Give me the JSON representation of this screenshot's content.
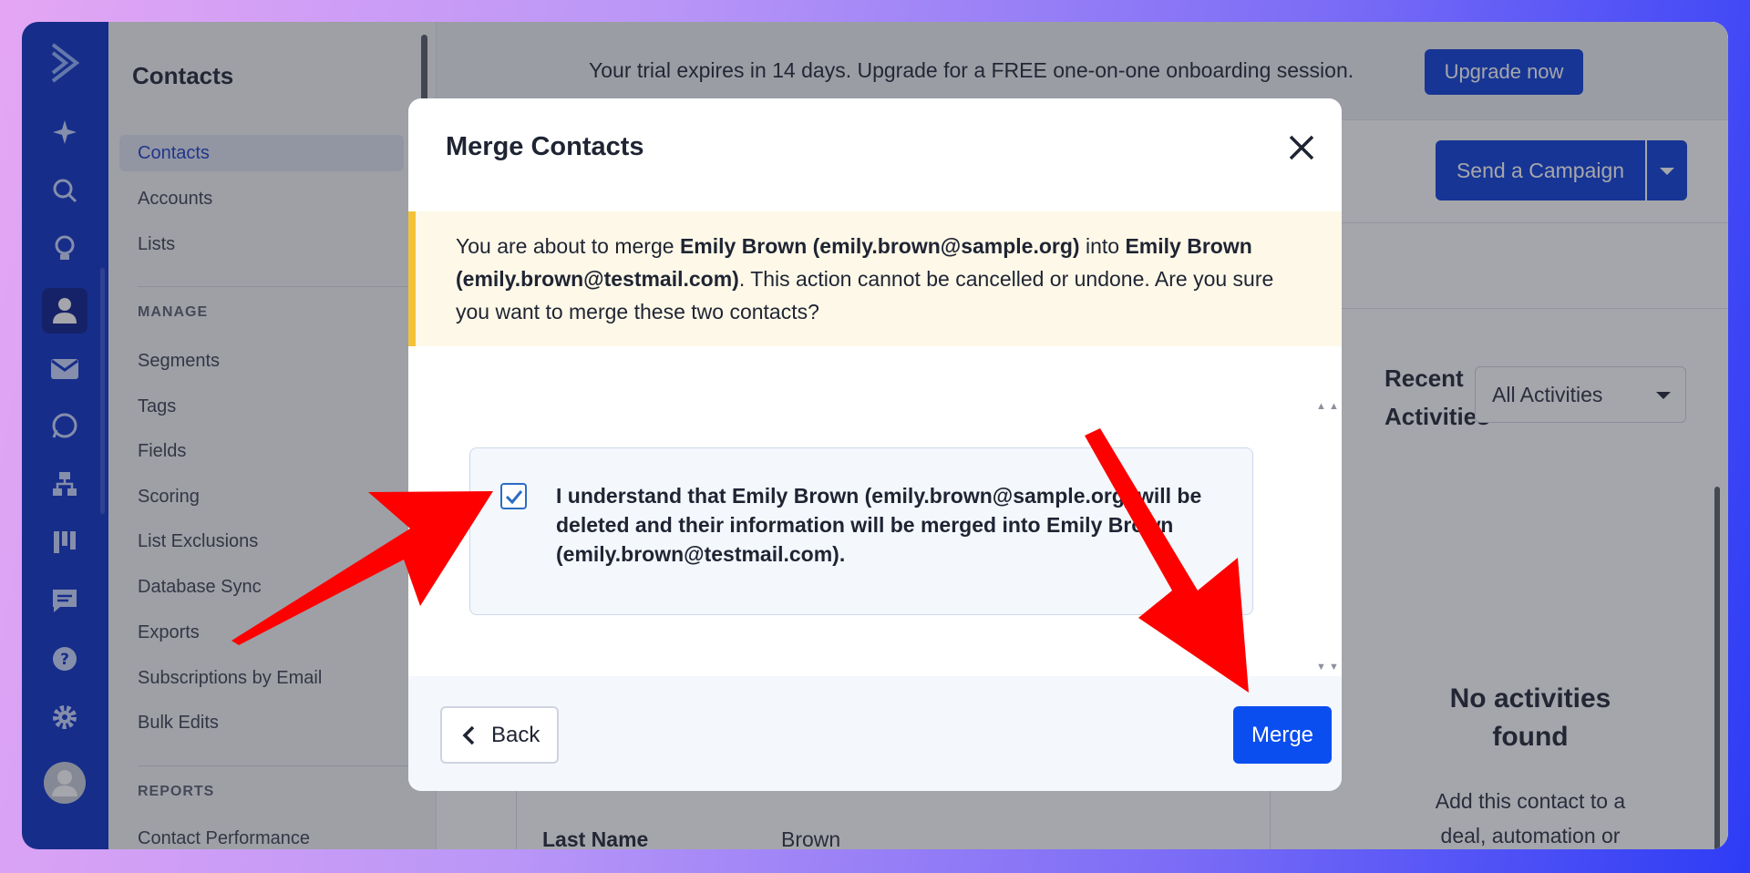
{
  "sidebar": {
    "title": "Contacts",
    "items_top": [
      {
        "label": "Contacts",
        "active": true
      },
      {
        "label": "Accounts"
      },
      {
        "label": "Lists"
      }
    ],
    "manage_heading": "MANAGE",
    "manage_items": [
      {
        "label": "Segments"
      },
      {
        "label": "Tags"
      },
      {
        "label": "Fields"
      },
      {
        "label": "Scoring"
      },
      {
        "label": "List Exclusions"
      },
      {
        "label": "Database Sync"
      },
      {
        "label": "Exports"
      },
      {
        "label": "Subscriptions by Email"
      },
      {
        "label": "Bulk Edits"
      }
    ],
    "reports_heading": "REPORTS",
    "reports_items": [
      {
        "label": "Contact Performance"
      }
    ]
  },
  "rail_icons": [
    "logo-chevron-icon",
    "sparkle-icon",
    "search-icon",
    "lightbulb-icon",
    "contacts-icon",
    "mail-icon",
    "whatsapp-icon",
    "automation-icon",
    "pipeline-icon",
    "chat-icon",
    "help-icon",
    "settings-icon",
    "user-avatar-icon"
  ],
  "topbar": {
    "trial_text": "Your trial expires in 14 days. Upgrade for a FREE one-on-one onboarding session.",
    "upgrade_label": "Upgrade now"
  },
  "header": {
    "campaign_label": "Send a Campaign"
  },
  "activities": {
    "heading": "Recent Activities",
    "filter_value": "All Activities",
    "empty_title": "No activities found",
    "empty_text": "Add this contact to a deal, automation or"
  },
  "contact_fields": {
    "last_name_label": "Last Name",
    "last_name_value": "Brown"
  },
  "modal": {
    "title": "Merge Contacts",
    "warning": {
      "p1": "You are about to merge ",
      "b1": "Emily Brown (emily.brown@sample.org)",
      "p2": " into ",
      "b2": "Emily Brown (emily.brown@testmail.com)",
      "p3": ". This action cannot be cancelled or undone. Are you sure you want to merge these two contacts?"
    },
    "confirm_text": "I understand that Emily Brown (emily.brown@sample.org) will be deleted and their information will be merged into Emily Brown (emily.brown@testmail.com).",
    "confirm_checked": true,
    "back_label": "Back",
    "merge_label": "Merge"
  },
  "colors": {
    "brand": "#0b2fc6",
    "primary_button": "#0b4ef0",
    "warning_accent": "#f3c23a",
    "annotation_arrow": "#ff0000"
  }
}
